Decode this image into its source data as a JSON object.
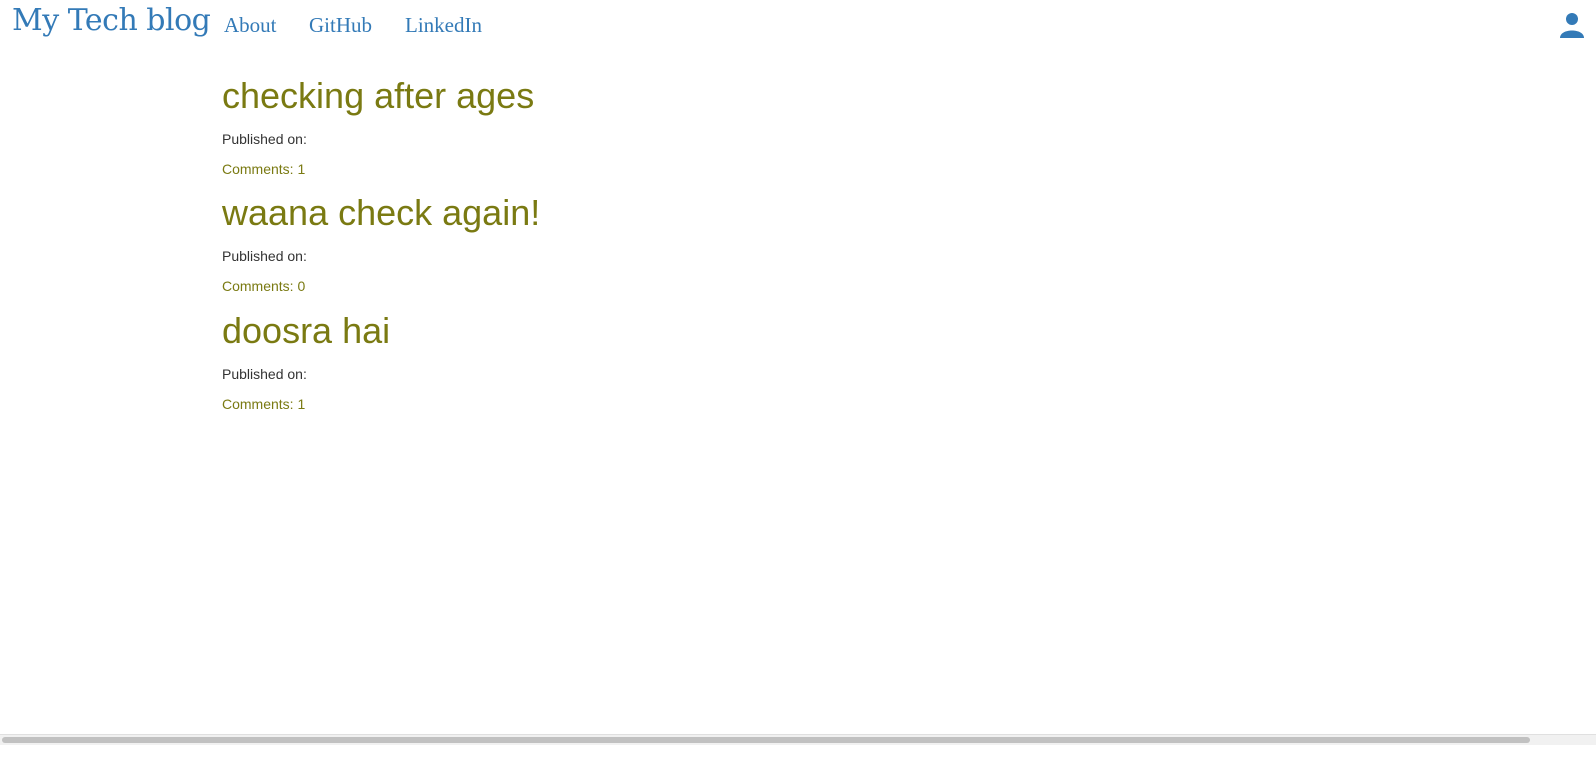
{
  "navbar": {
    "brand": "My Tech blog",
    "links": [
      {
        "label": "About"
      },
      {
        "label": "GitHub"
      },
      {
        "label": "LinkedIn"
      }
    ],
    "user_icon": "user-icon"
  },
  "posts": [
    {
      "title": "checking after ages",
      "published_label": "Published on:",
      "comments_label": "Comments: 1"
    },
    {
      "title": "waana check again!",
      "published_label": "Published on:",
      "comments_label": "Comments: 0"
    },
    {
      "title": "doosra hai",
      "published_label": "Published on:",
      "comments_label": "Comments: 1"
    }
  ],
  "colors": {
    "link": "#337ab7",
    "post_accent": "#7a7a12",
    "text": "#333333",
    "background": "#ffffff"
  }
}
